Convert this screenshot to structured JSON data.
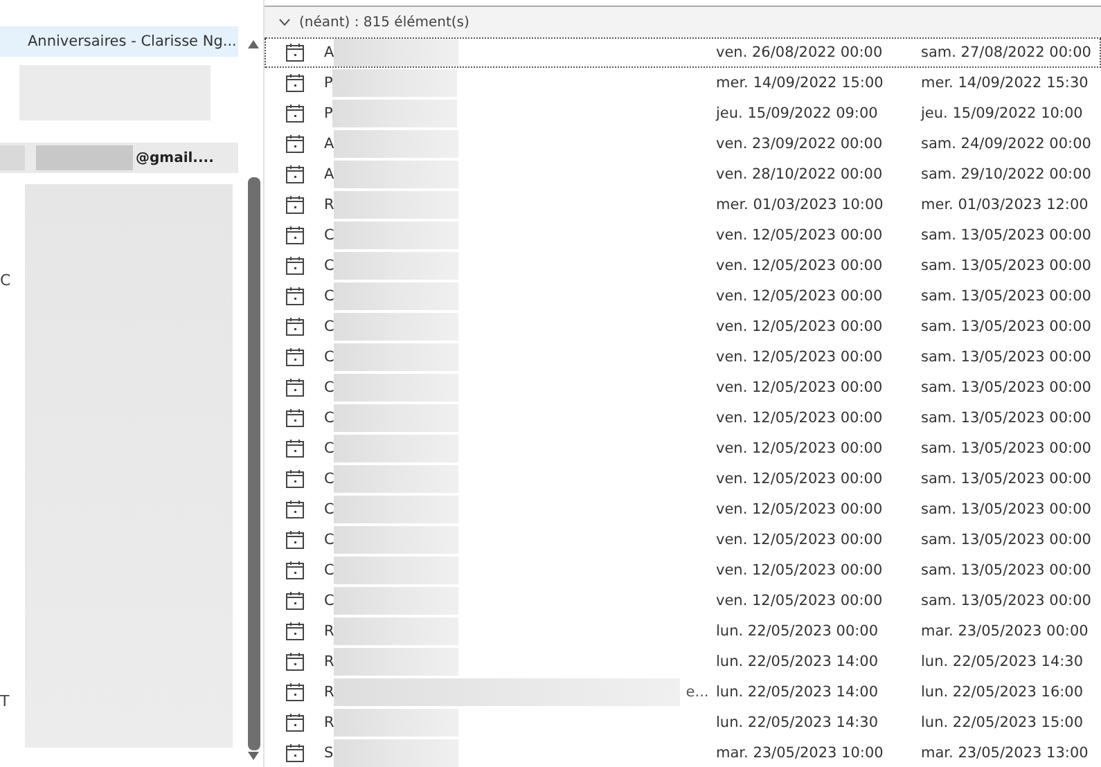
{
  "sidebar": {
    "items": [
      {
        "kind": "calendar",
        "label": "Anniversaires - Clarisse Ng...",
        "selected": true
      },
      {
        "kind": "redacted"
      },
      {
        "kind": "account",
        "label": "@gmail....",
        "selected": false
      },
      {
        "kind": "redacted_tall"
      }
    ],
    "cut_labels": [
      "C",
      "T"
    ]
  },
  "group": {
    "label": "(néant) : 815 élément(s)",
    "expanded": true
  },
  "rows": [
    {
      "title": "A",
      "start": "ven. 26/08/2022 00:00",
      "end": "sam. 27/08/2022 00:00",
      "selected": true
    },
    {
      "title": "P",
      "start": "mer. 14/09/2022 15:00",
      "end": "mer. 14/09/2022 15:30",
      "selected": false
    },
    {
      "title": "P",
      "start": "jeu. 15/09/2022 09:00",
      "end": "jeu. 15/09/2022 10:00",
      "selected": false
    },
    {
      "title": "A",
      "start": "ven. 23/09/2022 00:00",
      "end": "sam. 24/09/2022 00:00",
      "selected": false
    },
    {
      "title": "A",
      "start": "ven. 28/10/2022 00:00",
      "end": "sam. 29/10/2022 00:00",
      "selected": false
    },
    {
      "title": "R",
      "start": "mer. 01/03/2023 10:00",
      "end": "mer. 01/03/2023 12:00",
      "selected": false
    },
    {
      "title": "C",
      "start": "ven. 12/05/2023 00:00",
      "end": "sam. 13/05/2023 00:00",
      "selected": false
    },
    {
      "title": "C",
      "start": "ven. 12/05/2023 00:00",
      "end": "sam. 13/05/2023 00:00",
      "selected": false
    },
    {
      "title": "C",
      "start": "ven. 12/05/2023 00:00",
      "end": "sam. 13/05/2023 00:00",
      "selected": false
    },
    {
      "title": "C",
      "start": "ven. 12/05/2023 00:00",
      "end": "sam. 13/05/2023 00:00",
      "selected": false
    },
    {
      "title": "C",
      "start": "ven. 12/05/2023 00:00",
      "end": "sam. 13/05/2023 00:00",
      "selected": false
    },
    {
      "title": "C",
      "start": "ven. 12/05/2023 00:00",
      "end": "sam. 13/05/2023 00:00",
      "selected": false
    },
    {
      "title": "C",
      "start": "ven. 12/05/2023 00:00",
      "end": "sam. 13/05/2023 00:00",
      "selected": false
    },
    {
      "title": "C",
      "start": "ven. 12/05/2023 00:00",
      "end": "sam. 13/05/2023 00:00",
      "selected": false
    },
    {
      "title": "C",
      "start": "ven. 12/05/2023 00:00",
      "end": "sam. 13/05/2023 00:00",
      "selected": false
    },
    {
      "title": "C",
      "start": "ven. 12/05/2023 00:00",
      "end": "sam. 13/05/2023 00:00",
      "selected": false
    },
    {
      "title": "C",
      "start": "ven. 12/05/2023 00:00",
      "end": "sam. 13/05/2023 00:00",
      "selected": false
    },
    {
      "title": "C",
      "start": "ven. 12/05/2023 00:00",
      "end": "sam. 13/05/2023 00:00",
      "selected": false
    },
    {
      "title": "C",
      "start": "ven. 12/05/2023 00:00",
      "end": "sam. 13/05/2023 00:00",
      "selected": false
    },
    {
      "title": "R",
      "start": "lun. 22/05/2023 00:00",
      "end": "mar. 23/05/2023 00:00",
      "selected": false
    },
    {
      "title": "R",
      "start": "lun. 22/05/2023 14:00",
      "end": "lun. 22/05/2023 14:30",
      "selected": false
    },
    {
      "title": "R",
      "title_end": "e...",
      "start": "lun. 22/05/2023 14:00",
      "end": "lun. 22/05/2023 16:00",
      "selected": false
    },
    {
      "title": "R",
      "start": "lun. 22/05/2023 14:30",
      "end": "lun. 22/05/2023 15:00",
      "selected": false
    },
    {
      "title": "S",
      "start": "mar. 23/05/2023 10:00",
      "end": "mar. 23/05/2023 13:00",
      "selected": false
    }
  ]
}
